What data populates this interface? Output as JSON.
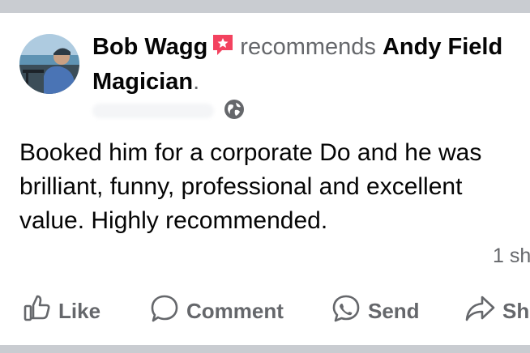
{
  "post": {
    "author": "Bob Wagg",
    "verb": "recommends",
    "page_name": "Andy Field Magician",
    "period": ".",
    "body": "Booked him for a corporate Do and he was\nbrilliant, funny, professional and excellent\nvalue. Highly recommended.",
    "shares": "1 sh"
  },
  "actions": {
    "like": "Like",
    "comment": "Comment",
    "send": "Send",
    "share": "Sh"
  },
  "icons": {
    "recommend_badge": "star-flag-icon",
    "audience": "globe-icon",
    "like": "thumbs-up-icon",
    "comment": "comment-bubble-icon",
    "send": "messenger-icon",
    "share": "share-arrow-icon"
  },
  "colors": {
    "secondary_text": "#65676b",
    "primary_text": "#050505",
    "badge": "#f3425f",
    "divider": "#c9ccd1"
  }
}
